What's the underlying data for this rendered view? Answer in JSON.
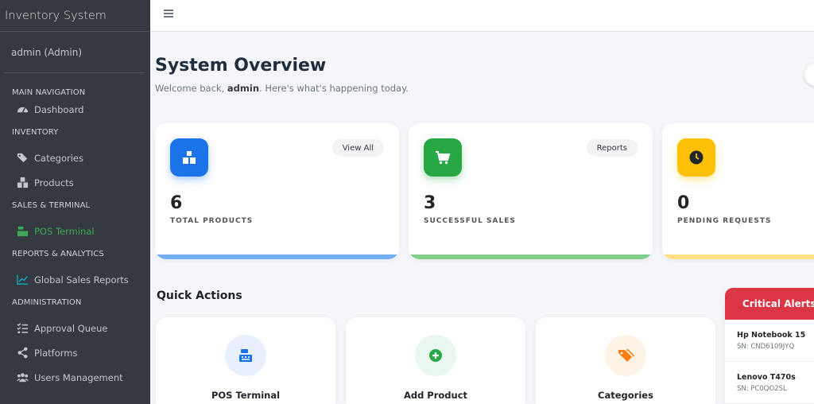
{
  "sidebar": {
    "brand": "Inventory System",
    "user": "admin (Admin)",
    "sections": {
      "main": "MAIN NAVIGATION",
      "inventory": "INVENTORY",
      "sales": "SALES & TERMINAL",
      "reports": "REPORTS & ANALYTICS",
      "admin": "ADMINISTRATION"
    },
    "items": {
      "dashboard": "Dashboard",
      "categories": "Categories",
      "products": "Products",
      "pos": "POS Terminal",
      "global_reports": "Global Sales Reports",
      "approval": "Approval Queue",
      "platforms": "Platforms",
      "users": "Users Management"
    },
    "active_color": "#3fa856"
  },
  "header": {
    "title": "System Overview",
    "welcome_pre": "Welcome back, ",
    "welcome_user": "admin",
    "welcome_post": ". Here's what's happening today."
  },
  "stats": [
    {
      "value": "6",
      "label": "TOTAL PRODUCTS",
      "button": "View All",
      "color": "#1a73e8",
      "bar": "#74adf3",
      "icon": "boxes-icon"
    },
    {
      "value": "3",
      "label": "SUCCESSFUL SALES",
      "button": "Reports",
      "color": "#28a745",
      "bar": "#82cf8e",
      "icon": "cart-icon"
    },
    {
      "value": "0",
      "label": "PENDING REQUESTS",
      "color": "#ffc107",
      "bar": "#ffe083",
      "icon": "clock-icon"
    }
  ],
  "quick_actions": {
    "title": "Quick Actions",
    "items": [
      {
        "label": "POS Terminal",
        "icon": "cash-register-icon"
      },
      {
        "label": "Add Product",
        "icon": "plus-circle-icon"
      },
      {
        "label": "Categories",
        "icon": "tags-icon"
      }
    ]
  },
  "alerts": {
    "title": "Critical Alerts",
    "items": [
      {
        "name": "Hp Notebook 15",
        "serial": "SN: CND6109JYQ"
      },
      {
        "name": "Lenovo T470s",
        "serial": "SN: PC0QO2SL"
      }
    ]
  }
}
